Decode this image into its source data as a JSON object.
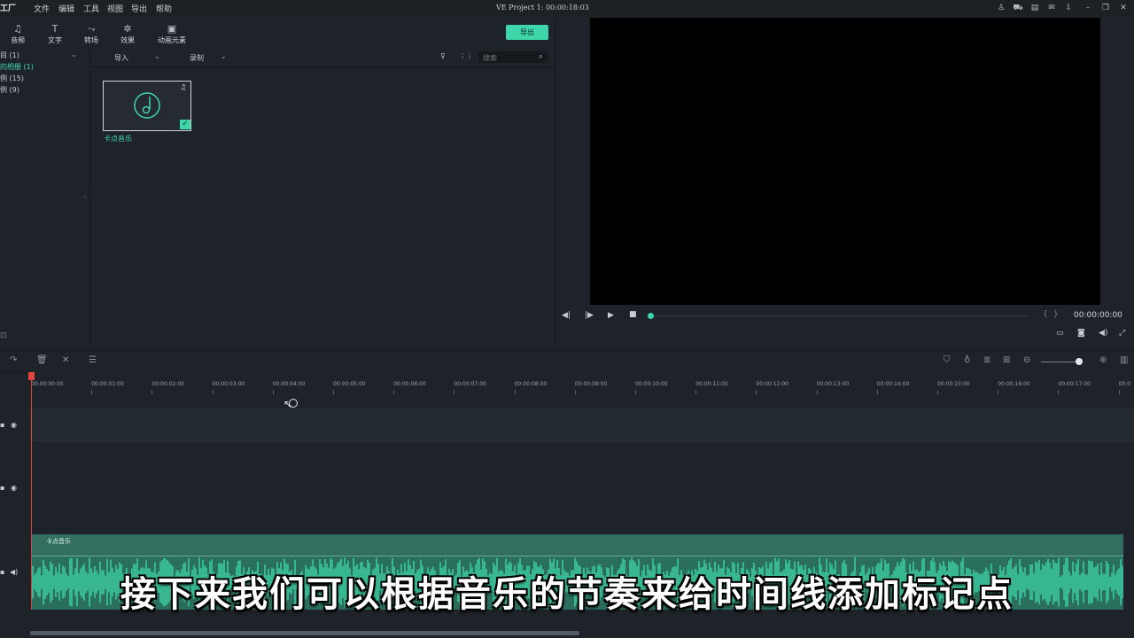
{
  "app": {
    "logo": "工厂",
    "title": "VE Project 1: 00:00:18:03"
  },
  "menu": [
    "文件",
    "编辑",
    "工具",
    "视图",
    "导出",
    "帮助"
  ],
  "toolbar": {
    "tools": [
      {
        "label": "音频",
        "icon": "♫"
      },
      {
        "label": "文字",
        "icon": "T"
      },
      {
        "label": "转场",
        "icon": "⤳"
      },
      {
        "label": "效果",
        "icon": "✲"
      },
      {
        "label": "动画元素",
        "icon": "▣"
      }
    ],
    "export_label": "导出"
  },
  "sidebar": {
    "items": [
      "目 (1)",
      "的相册 (1)",
      "例 (15)",
      "例 (9)"
    ]
  },
  "media": {
    "import_label": "导入",
    "record_label": "录制",
    "search_placeholder": "搜索",
    "clip_label": "卡点音乐"
  },
  "preview": {
    "timecode": "00:00:00:00"
  },
  "timeline": {
    "ticks": [
      "00:00:00:00",
      "00:00:01:00",
      "00:00:02:00",
      "00:00:03:00",
      "00:00:04:00",
      "00:00:05:00",
      "00:00:06:00",
      "00:00:07:00",
      "00:00:08:00",
      "00:00:09:00",
      "00:00:10:00",
      "00:00:11:00",
      "00:00:12:00",
      "00:00:13:00",
      "00:00:14:00",
      "00:00:15:00",
      "00:00:16:00",
      "00:00:17:00",
      "00:0"
    ],
    "audio_clip_label": "卡点音乐"
  },
  "subtitle": "接下来我们可以根据音乐的节奏来给时间线添加标记点",
  "colors": {
    "accent": "#3fd6a9",
    "playhead": "#e2453b",
    "clip": "#2a6e5d"
  }
}
